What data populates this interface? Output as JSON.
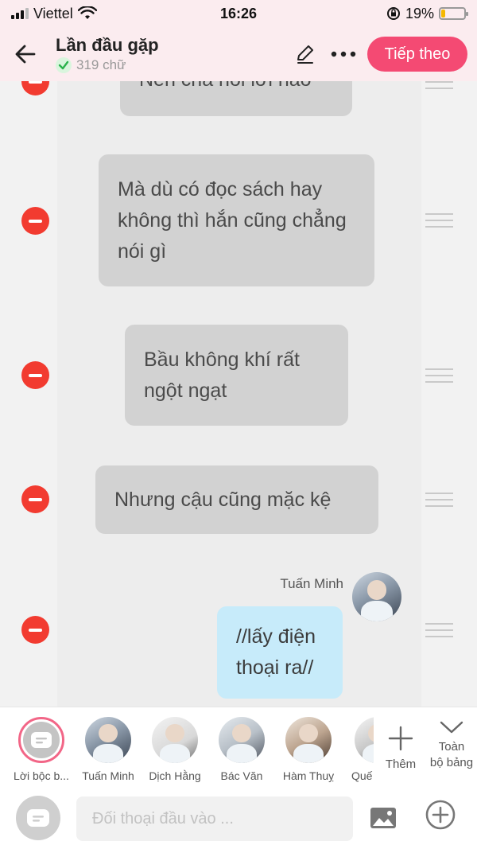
{
  "status_bar": {
    "carrier": "Viettel",
    "time": "16:26",
    "battery_percent": "19%",
    "battery_level": 0.19,
    "icons": [
      "signal-icon",
      "wifi-icon",
      "rotation-lock-icon",
      "battery-icon"
    ]
  },
  "header": {
    "title": "Lần đầu gặp",
    "word_count": "319 chữ",
    "next_label": "Tiếp theo",
    "icons": [
      "back-arrow-icon",
      "check-icon",
      "pencil-icon",
      "more-icon"
    ]
  },
  "messages": [
    {
      "speaker": "",
      "text": "Nên chả nói lời nào",
      "kind": "narration"
    },
    {
      "speaker": "",
      "text": "Mà dù có đọc sách hay không thì hắn cũng chẳng nói gì",
      "kind": "narration"
    },
    {
      "speaker": "",
      "text": "Bầu không khí rất ngột ngạt",
      "kind": "narration"
    },
    {
      "speaker": "",
      "text": "Nhưng cậu cũng mặc kệ",
      "kind": "narration"
    },
    {
      "speaker": "Tuấn Minh",
      "text": "//lấy điện thoại ra//",
      "kind": "character"
    }
  ],
  "characters": [
    {
      "name": "Lời bộc b..."
    },
    {
      "name": "Tuấn Minh"
    },
    {
      "name": "Dịch Hằng"
    },
    {
      "name": "Bác Văn"
    },
    {
      "name": "Hàm Thuỵ"
    },
    {
      "name": "Quế"
    }
  ],
  "character_bar": {
    "more_label": "Thêm",
    "all_label_line1": "Toàn",
    "all_label_line2": "bộ bảng"
  },
  "input": {
    "placeholder": "Đối thoại đầu vào ...",
    "icons": [
      "narration-icon",
      "image-icon",
      "add-circle-icon"
    ]
  },
  "colors": {
    "accent": "#f44a73",
    "delete": "#f23b30",
    "narration_bubble": "#d2d2d2",
    "user_bubble": "#c7ebfa",
    "header_bg": "#fbecef"
  }
}
